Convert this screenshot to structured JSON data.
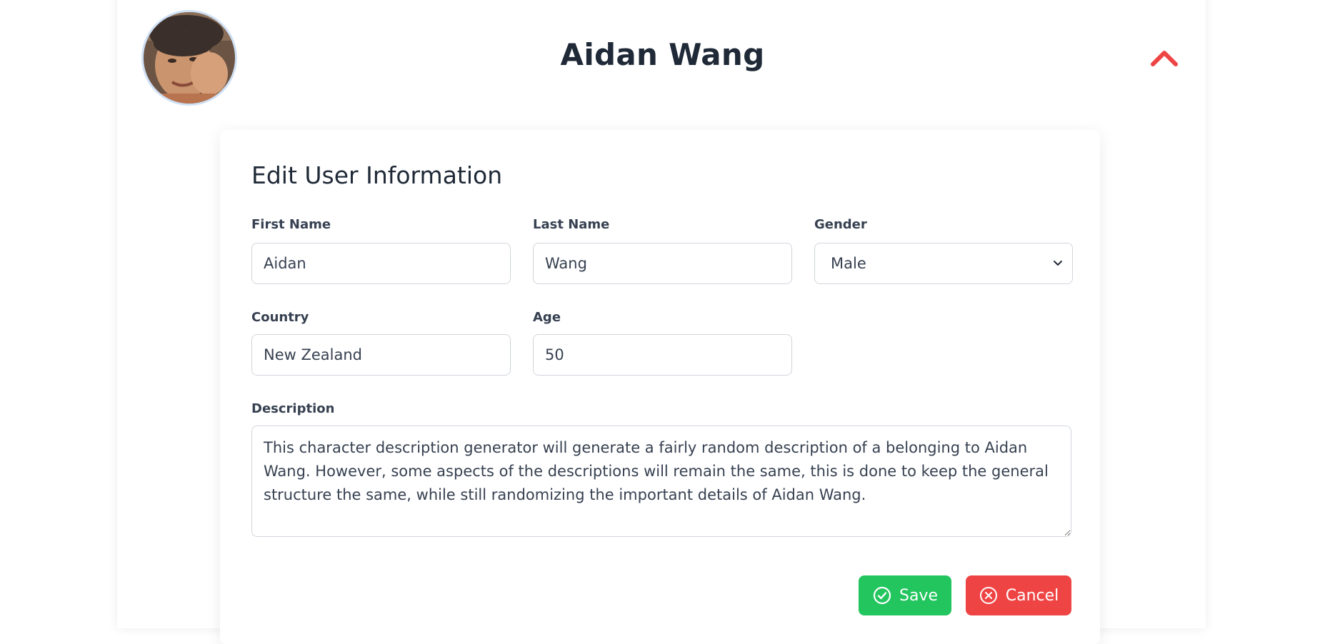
{
  "profile": {
    "name": "Aidan Wang",
    "avatar_icon": "user-photo",
    "toggle_icon": "chevron-up-icon",
    "accent_color": "#ef4444"
  },
  "form": {
    "heading": "Edit User Information",
    "first_name": {
      "label": "First Name",
      "value": "Aidan"
    },
    "last_name": {
      "label": "Last Name",
      "value": "Wang"
    },
    "gender": {
      "label": "Gender",
      "value": "Male"
    },
    "country": {
      "label": "Country",
      "value": "New Zealand"
    },
    "age": {
      "label": "Age",
      "value": "50"
    },
    "description": {
      "label": "Description",
      "value": "This character description generator will generate a fairly random description of a belonging to Aidan Wang. However, some aspects of the descriptions will remain the same, this is done to keep the general structure the same, while still randomizing the important details of Aidan Wang."
    }
  },
  "actions": {
    "save_label": "Save",
    "save_icon": "check-circle-icon",
    "save_color": "#22c55e",
    "cancel_label": "Cancel",
    "cancel_icon": "x-circle-icon",
    "cancel_color": "#ef4444"
  }
}
